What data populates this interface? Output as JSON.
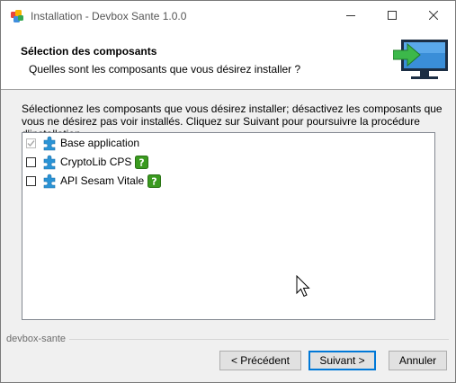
{
  "window": {
    "title": "Installation - Devbox Sante 1.0.0"
  },
  "header": {
    "title": "Sélection des composants",
    "subtitle": "Quelles sont les composants que vous désirez installer ?"
  },
  "description": "Sélectionnez les composants que vous désirez installer; désactivez les composants que vous ne désirez pas voir installés. Cliquez sur Suivant pour poursuivre la procédure d'installation.",
  "components": [
    {
      "label": "Base application",
      "checked": true,
      "disabled": true,
      "help": false
    },
    {
      "label": "CryptoLib CPS",
      "checked": false,
      "disabled": false,
      "help": true
    },
    {
      "label": "API Sesam Vitale",
      "checked": false,
      "disabled": false,
      "help": true
    }
  ],
  "footer": {
    "brand": "devbox-sante"
  },
  "buttons": {
    "back": "< Précédent",
    "next": "Suivant >",
    "cancel": "Annuler"
  },
  "colors": {
    "accent": "#0078d7",
    "puzzle": "#2a93d5",
    "help_green": "#3a9a1f",
    "monitor_arrow": "#3cb84a"
  },
  "icons": [
    "app-icon",
    "minimize-icon",
    "maximize-icon",
    "close-icon",
    "monitor-install-icon",
    "puzzle-icon",
    "help-icon",
    "mouse-cursor-icon"
  ]
}
